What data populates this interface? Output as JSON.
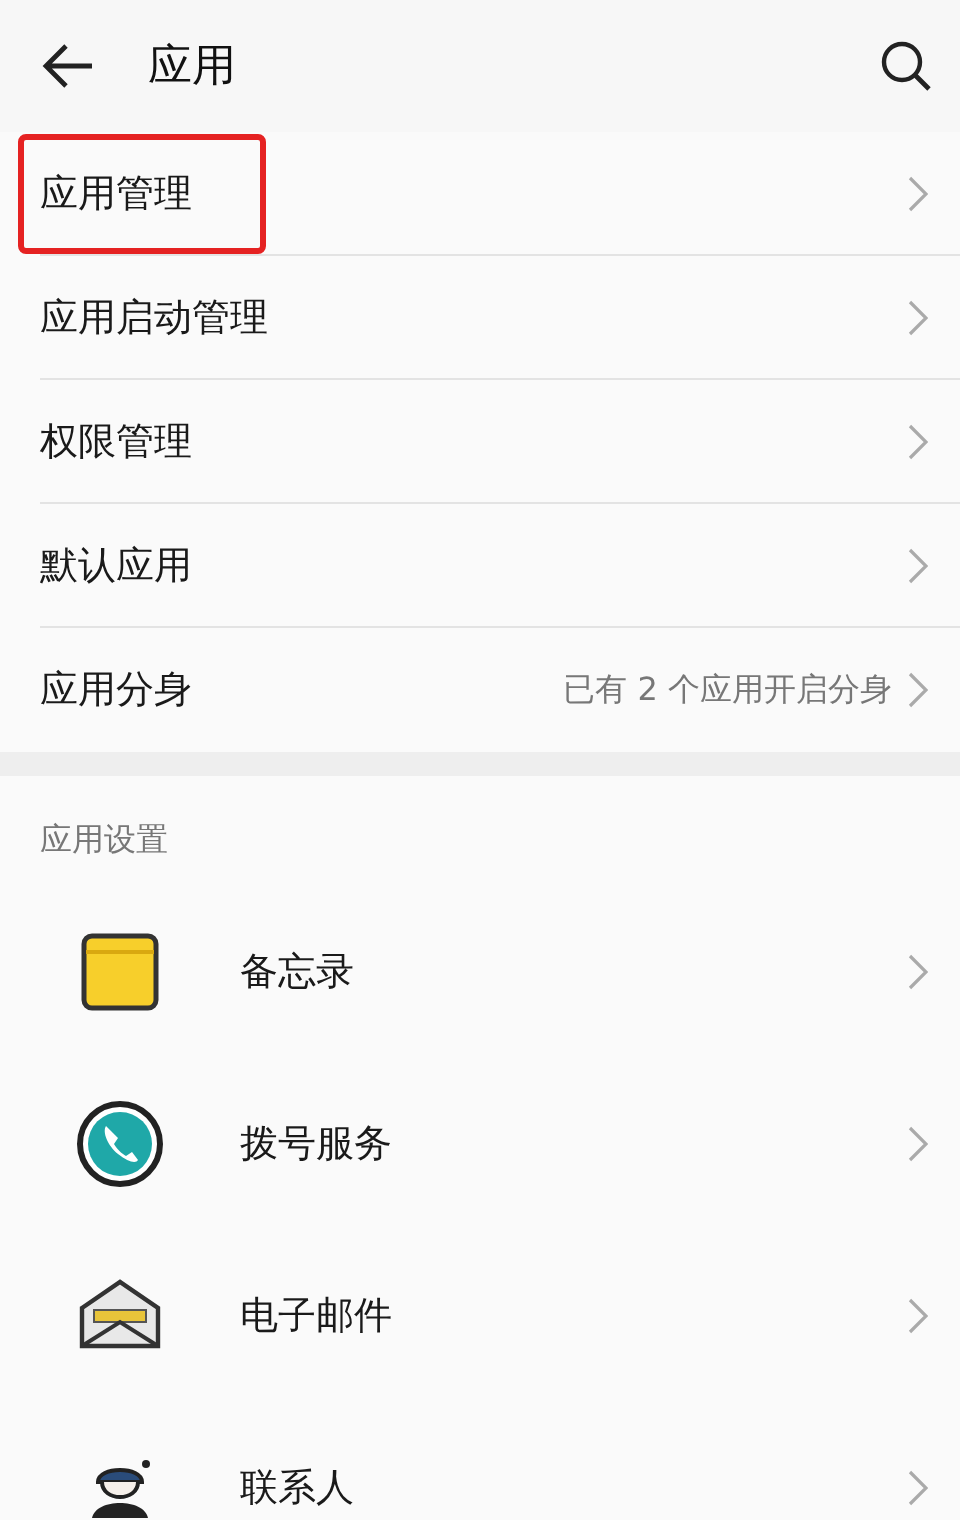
{
  "header": {
    "title": "应用"
  },
  "items": [
    {
      "label": "应用管理",
      "highlighted": true
    },
    {
      "label": "应用启动管理",
      "highlighted": false
    },
    {
      "label": "权限管理",
      "highlighted": false
    },
    {
      "label": "默认应用",
      "highlighted": false
    },
    {
      "label": "应用分身",
      "highlighted": false,
      "value": "已有 2 个应用开启分身"
    }
  ],
  "section": {
    "title": "应用设置"
  },
  "apps": [
    {
      "label": "备忘录",
      "kind": "notes"
    },
    {
      "label": "拨号服务",
      "kind": "phone"
    },
    {
      "label": "电子邮件",
      "kind": "mail"
    },
    {
      "label": "联系人",
      "kind": "contact"
    }
  ]
}
